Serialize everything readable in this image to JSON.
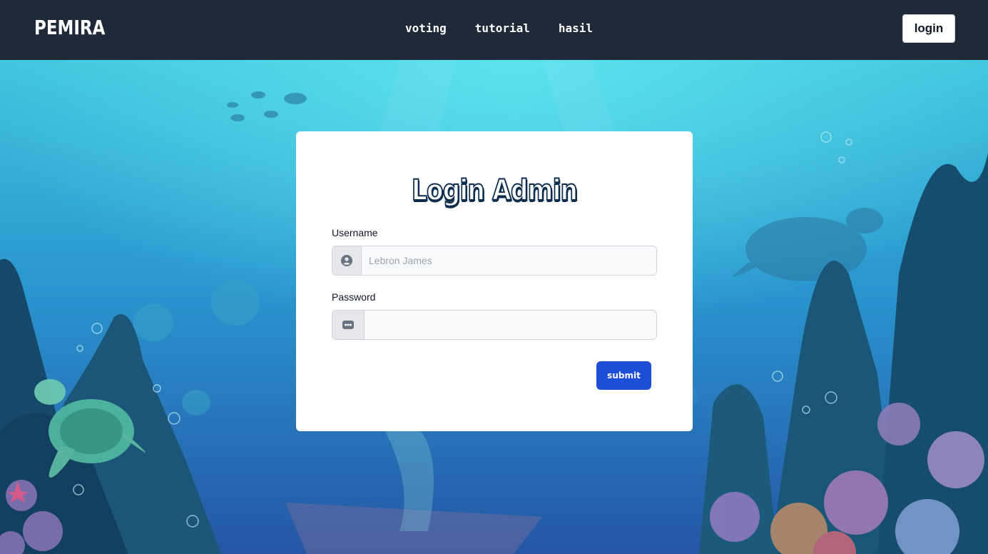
{
  "brand": "PEMIRA",
  "nav": {
    "links": [
      "voting",
      "tutorial",
      "hasil"
    ],
    "login_label": "login"
  },
  "card": {
    "title": "Login Admin",
    "username_label": "Username",
    "username_placeholder": "Lebron James",
    "password_label": "Password",
    "password_value": "",
    "submit_label": "submit"
  },
  "colors": {
    "navbar": "#1f2937",
    "submit": "#1d4ed8",
    "ocean_top": "#46d6e6",
    "ocean_bottom": "#1f4f9a"
  },
  "icons": {
    "username": "user-circle-icon",
    "password": "dots-icon"
  }
}
